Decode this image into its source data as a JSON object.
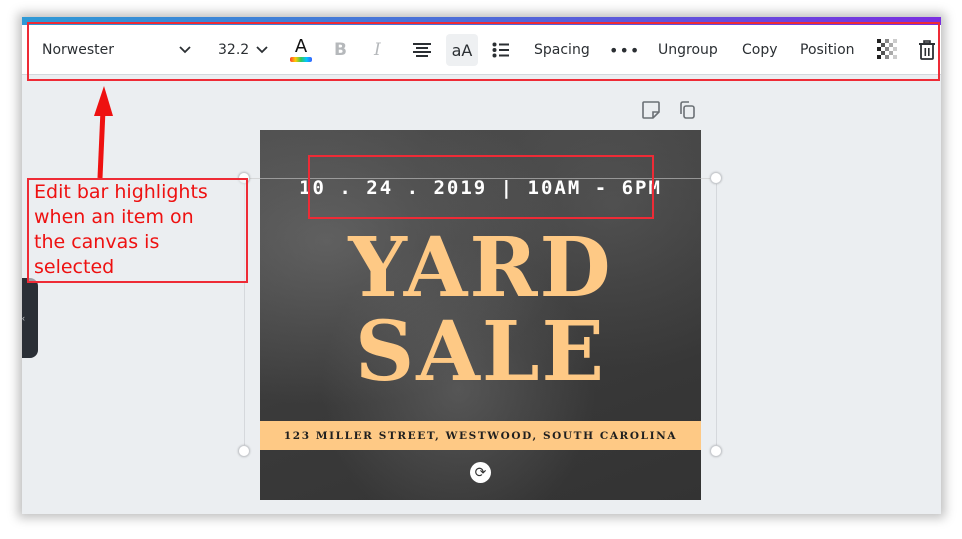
{
  "toolbar": {
    "font_family": "Norwester",
    "font_size": "32.2",
    "text_color_label": "A",
    "bold_label": "B",
    "italic_label": "I",
    "case_label": "aA",
    "spacing_label": "Spacing",
    "more_label": "•••",
    "ungroup_label": "Ungroup",
    "copy_label": "Copy",
    "position_label": "Position",
    "icons": {
      "font_dropdown": "chevron-down-icon",
      "size_dropdown": "chevron-down-icon",
      "text_color": "text-color-icon",
      "align": "align-center-icon",
      "list": "bulleted-list-icon",
      "transparency": "transparency-icon",
      "delete": "trash-icon"
    }
  },
  "side_tab": {
    "label": "‹"
  },
  "page_actions": {
    "note_icon": "sticky-note-icon",
    "duplicate_icon": "duplicate-page-icon"
  },
  "design": {
    "date_line": "10 . 24 . 2019 | 10AM - 6PM",
    "title_line_1": "YARD",
    "title_line_2": "SALE",
    "address": "123 MILLER STREET, WESTWOOD, SOUTH CAROLINA",
    "refresh_glyph": "⟳",
    "colors": {
      "accent": "#fec985",
      "background": "#3a3a3a",
      "text": "#ffffff"
    }
  },
  "annotation": {
    "callout_text": "Edit bar highlights\nwhen an item on\nthe canvas is\nselected",
    "highlight_color": "#ee2b36"
  },
  "colors": {
    "gradient_start": "#2f9ad6",
    "gradient_end": "#7b2fe0",
    "canvas_bg": "#ebeef1"
  }
}
